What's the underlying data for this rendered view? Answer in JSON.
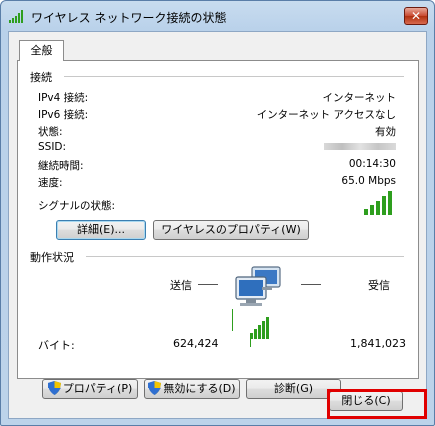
{
  "window": {
    "title": "ワイヤレス ネットワーク接続の状態",
    "close_glyph": "✕"
  },
  "tab": {
    "label": "全般"
  },
  "connection": {
    "heading": "接続",
    "rows": [
      {
        "label": "IPv4 接続:",
        "value": "インターネット"
      },
      {
        "label": "IPv6 接続:",
        "value": "インターネット アクセスなし"
      },
      {
        "label": "状態:",
        "value": "有効"
      },
      {
        "label": "SSID:",
        "value": ""
      },
      {
        "label": "継続時間:",
        "value": "00:14:30"
      },
      {
        "label": "速度:",
        "value": "65.0 Mbps"
      }
    ],
    "signal_label": "シグナルの状態:",
    "signal_bars": 5,
    "details_button": "詳細(E)...",
    "wireless_props_button": "ワイヤレスのプロパティ(W)"
  },
  "activity": {
    "heading": "動作状況",
    "sent_label": "送信",
    "received_label": "受信",
    "bytes_label": "バイト:",
    "bytes_sent": "624,424",
    "bytes_received": "1,841,023"
  },
  "actions": {
    "properties_button": "プロパティ(P)",
    "disable_button": "無効にする(D)",
    "diagnose_button": "診断(G)"
  },
  "footer": {
    "close_button": "閉じる(C)"
  },
  "colors": {
    "signal_green": "#2e9e1e",
    "highlight": "#e00000"
  }
}
